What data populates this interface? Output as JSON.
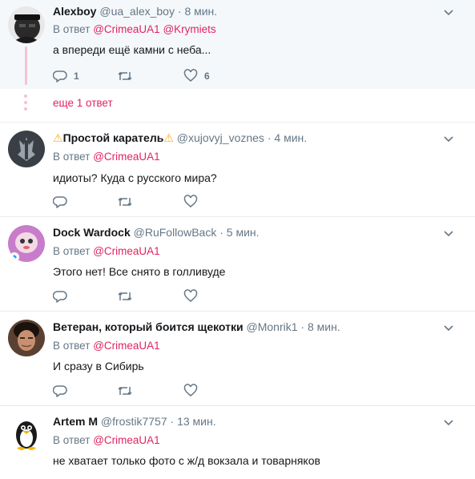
{
  "tweets": [
    {
      "name": "Alexboy",
      "handle": "@ua_alex_boy",
      "dot": "·",
      "time": "8 мин.",
      "replying_prefix": "В ответ",
      "mentions": [
        "@CrimeaUA1",
        "@Krymiets"
      ],
      "text": "а впереди ещё камни с неба...",
      "reply_count": "1",
      "retweet_count": "",
      "like_count": "6"
    },
    {
      "name_prefix_icon": "⚠",
      "name": "Простой каратель",
      "name_suffix_icon": "⚠",
      "handle": "@xujovyj_voznes",
      "dot": "·",
      "time": "4 мин.",
      "replying_prefix": "В ответ",
      "mentions": [
        "@CrimeaUA1"
      ],
      "text": "идиоты? Куда с русского мира?"
    },
    {
      "name": "Dock Wardock",
      "handle": "@RuFollowBack",
      "dot": "·",
      "time": "5 мин.",
      "replying_prefix": "В ответ",
      "mentions": [
        "@CrimeaUA1"
      ],
      "text": "Этого нет! Все снято в голливуде"
    },
    {
      "name": "Ветеран, который боится щекотки",
      "handle": "@Monrik1",
      "dot": "·",
      "time": "8 мин.",
      "replying_prefix": "В ответ",
      "mentions": [
        "@CrimeaUA1"
      ],
      "text": "И сразу в Сибирь"
    },
    {
      "name": "Artem M",
      "handle": "@frostik7757",
      "dot": "·",
      "time": "13 мин.",
      "replying_prefix": "В ответ",
      "mentions": [
        "@CrimeaUA1"
      ],
      "text": "не хватает только фото с ж/д вокзала и товарняков"
    }
  ],
  "more_replies": "еще 1 ответ",
  "icons": {
    "reply": "reply-icon",
    "retweet": "retweet-icon",
    "like": "heart-icon",
    "menu": "chevron-down-icon"
  },
  "colors": {
    "mention": "#e0245e",
    "muted": "#657786",
    "thread_line": "#f5c2d1",
    "highlight_bg": "#f5f8fa"
  }
}
